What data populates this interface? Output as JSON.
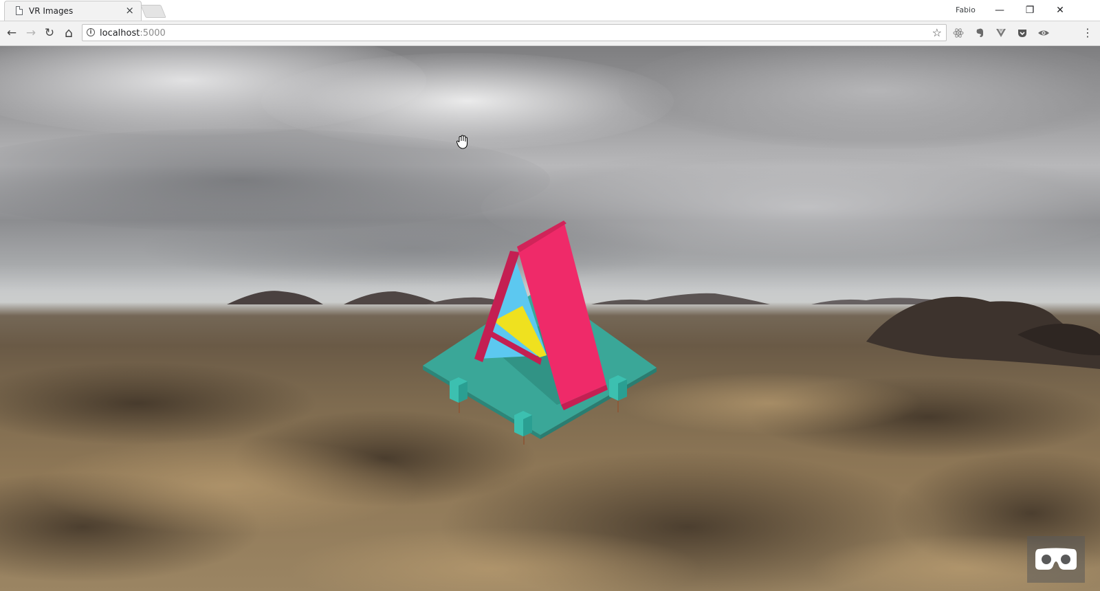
{
  "tab": {
    "title": "VR Images",
    "close_glyph": "×"
  },
  "profile": {
    "name": "Fabio"
  },
  "window_controls": {
    "minimize": "—",
    "restore": "❐",
    "close": "✕"
  },
  "toolbar": {
    "back": "←",
    "forward": "→",
    "reload": "↻",
    "home": "⌂",
    "info": "i",
    "url_host": "localhost",
    "url_port": ":5000",
    "star": "☆",
    "menu": "⋮"
  },
  "extensions": [
    "react-devtools-icon",
    "evernote-icon",
    "vue-devtools-icon",
    "pocket-icon",
    "eye-icon"
  ],
  "scene": {
    "model": "A-frame logo model",
    "colors": {
      "pink": "#ef2a69",
      "pink_dark": "#c41f52",
      "blue": "#5cc8f0",
      "yellow": "#efe11f",
      "teal": "#3aa798",
      "teal_dark": "#2c8679"
    }
  },
  "vr_button": {
    "icon": "vr-headset-icon"
  }
}
